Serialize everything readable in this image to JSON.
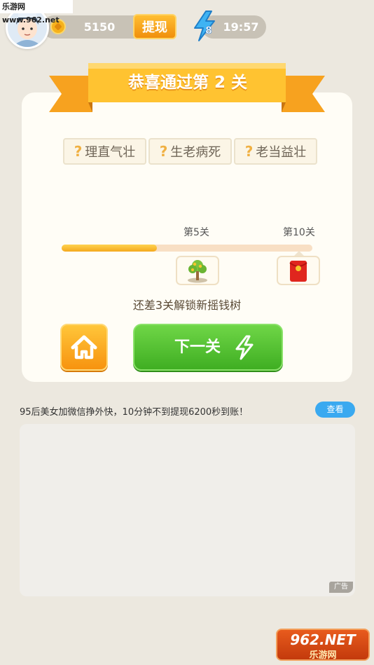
{
  "watermark": {
    "top": "乐游网 www.962.net",
    "bottom_logo": "962.NET",
    "bottom_sub": "乐游网"
  },
  "status": {
    "coins": "5150",
    "withdraw_label": "提现",
    "energy_count": "8",
    "timer": "19:57"
  },
  "level": {
    "title": "恭喜通过第 2 关",
    "idioms": [
      "理直气壮",
      "生老病死",
      "老当益壮"
    ],
    "unknown_mark": "?",
    "progress": {
      "milestone_1": "第5关",
      "milestone_2": "第10关",
      "fraction": 0.38
    },
    "hint": "还差3关解锁新摇钱树",
    "next_label": "下一关"
  },
  "ad": {
    "text": "95后美女加微信挣外快，10分钟不到提现6200秒到账！",
    "view_label": "查看",
    "tag": "广告"
  },
  "colors": {
    "accent_orange": "#f5a91e",
    "green": "#4cbf2c",
    "blue": "#3aa9f0"
  }
}
